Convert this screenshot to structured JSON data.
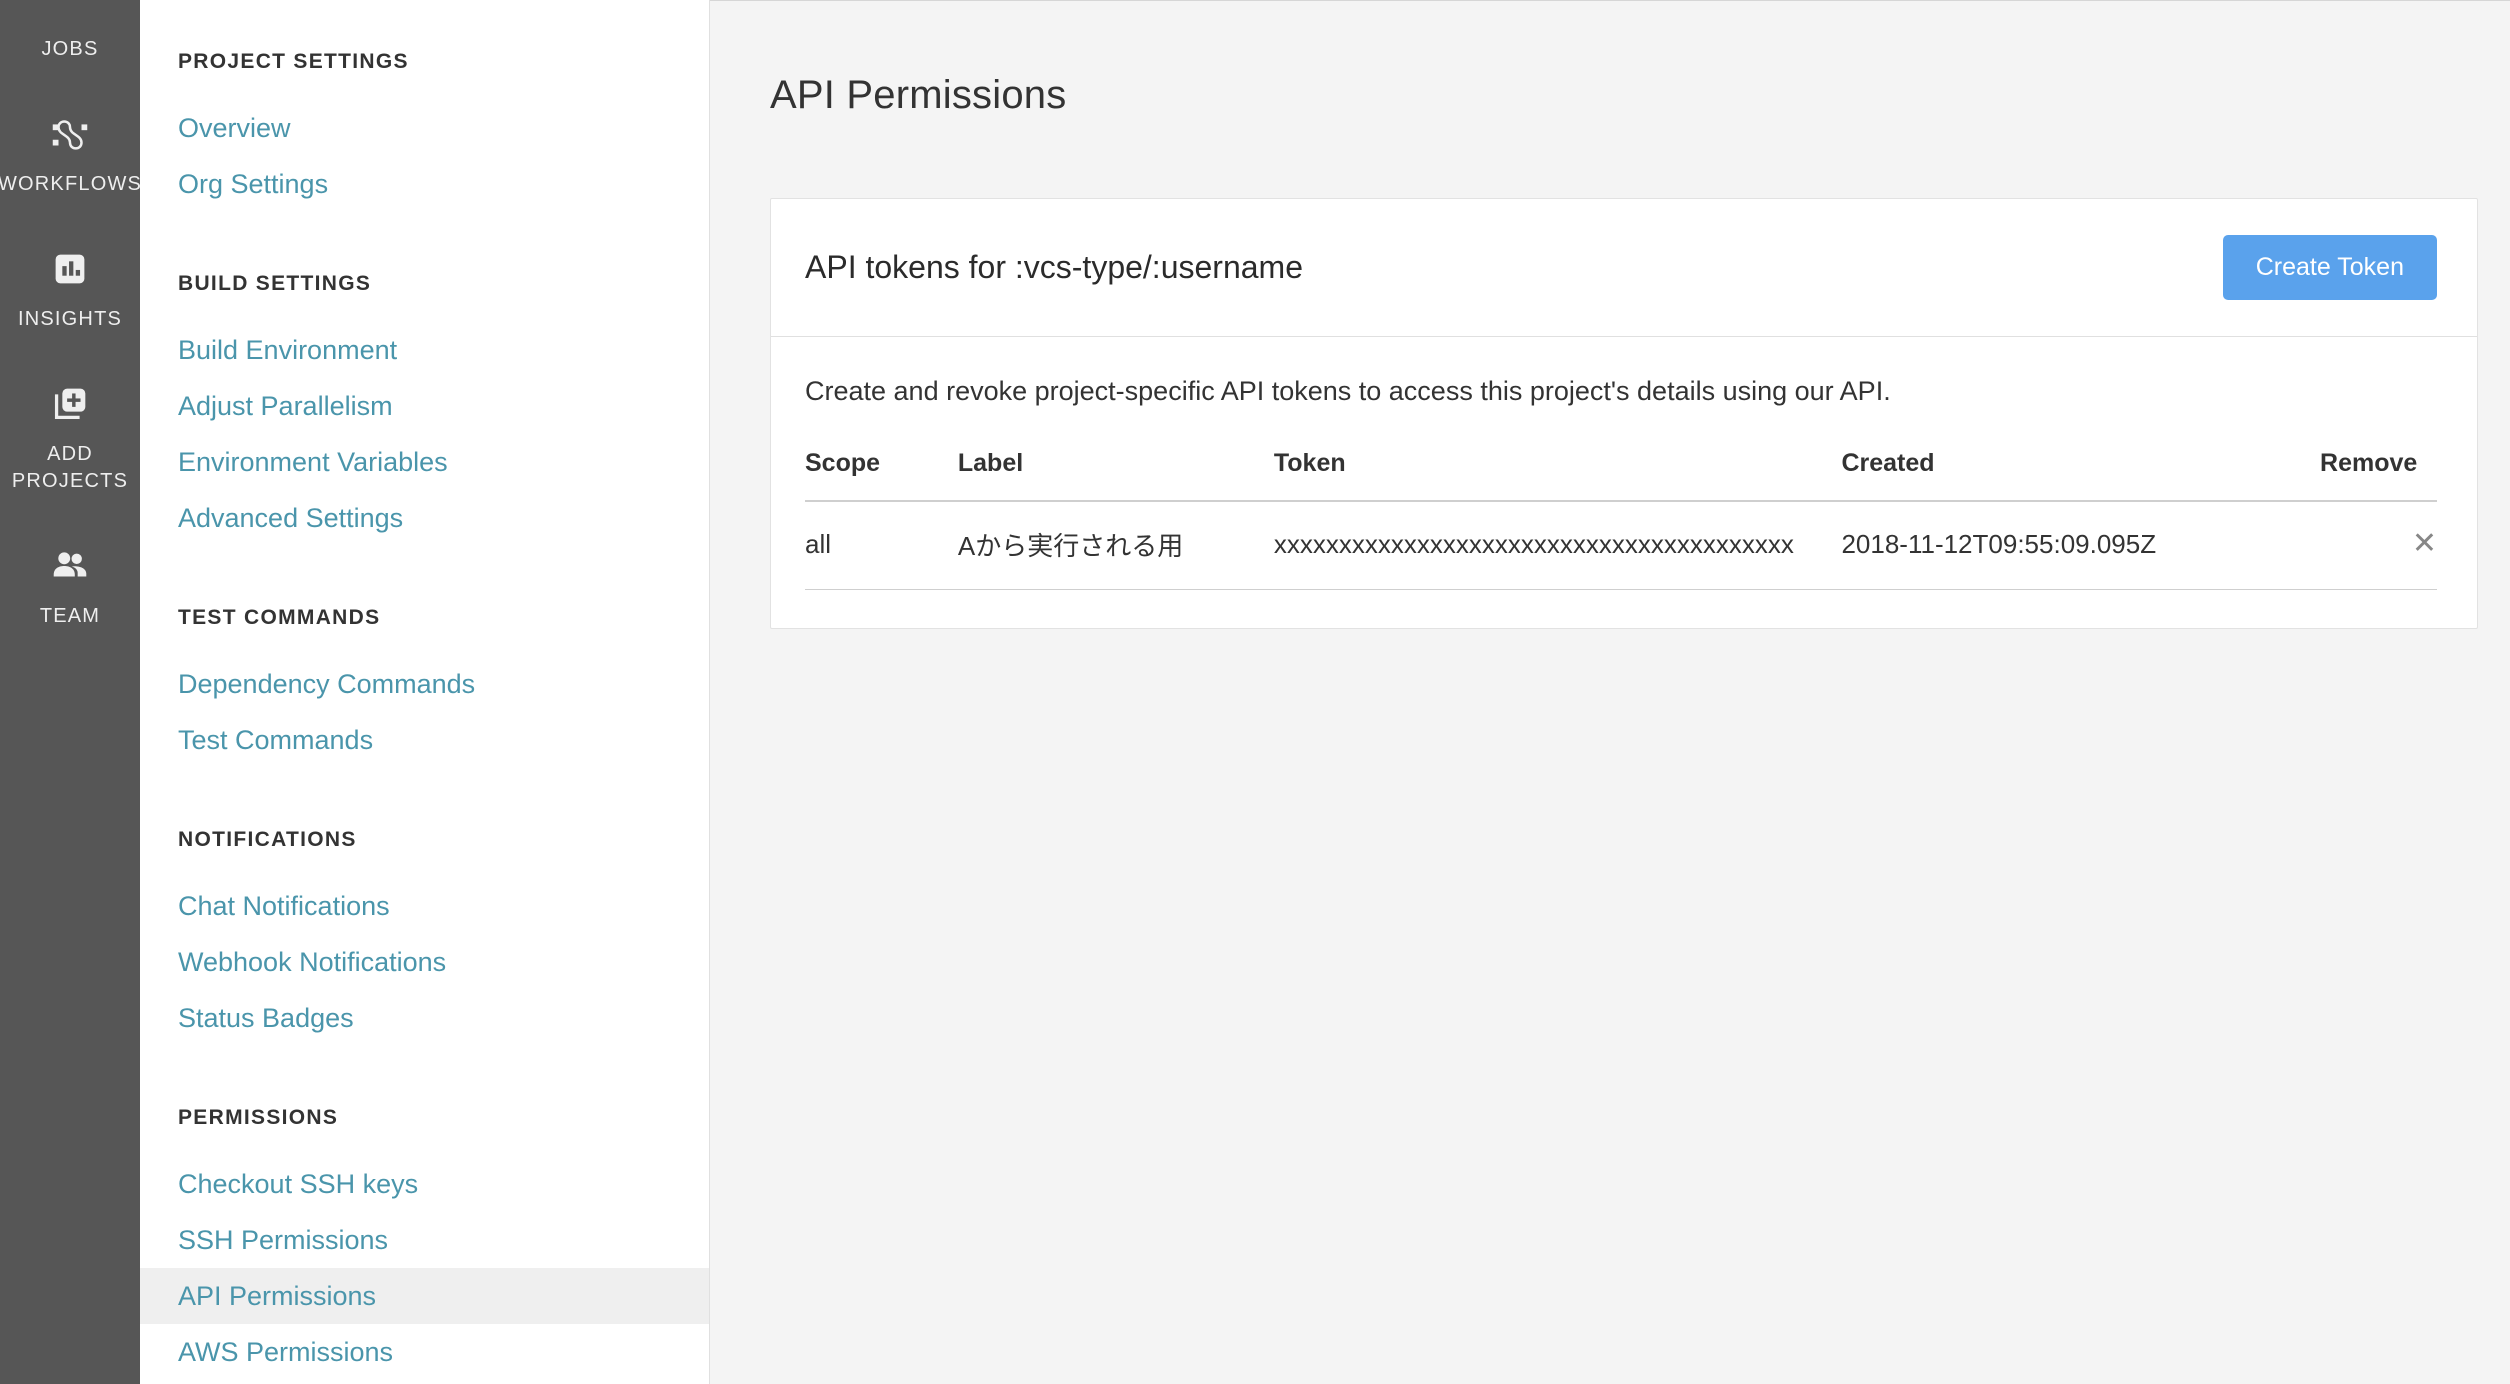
{
  "rail": {
    "items": [
      {
        "label": "JOBS",
        "icon": "jobs-icon",
        "clipped": true
      },
      {
        "label": "WORKFLOWS",
        "icon": "workflows-icon",
        "clipped": false
      },
      {
        "label": "INSIGHTS",
        "icon": "insights-icon",
        "clipped": false
      },
      {
        "label": "ADD PROJECTS",
        "icon": "add-projects-icon",
        "clipped": false
      },
      {
        "label": "TEAM",
        "icon": "team-icon",
        "clipped": false
      }
    ]
  },
  "settings_nav": {
    "sections": [
      {
        "heading": "PROJECT SETTINGS",
        "links": [
          {
            "label": "Overview",
            "active": false
          },
          {
            "label": "Org Settings",
            "active": false
          }
        ]
      },
      {
        "heading": "BUILD SETTINGS",
        "links": [
          {
            "label": "Build Environment",
            "active": false
          },
          {
            "label": "Adjust Parallelism",
            "active": false
          },
          {
            "label": "Environment Variables",
            "active": false
          },
          {
            "label": "Advanced Settings",
            "active": false
          }
        ]
      },
      {
        "heading": "TEST COMMANDS",
        "links": [
          {
            "label": "Dependency Commands",
            "active": false
          },
          {
            "label": "Test Commands",
            "active": false
          }
        ]
      },
      {
        "heading": "NOTIFICATIONS",
        "links": [
          {
            "label": "Chat Notifications",
            "active": false
          },
          {
            "label": "Webhook Notifications",
            "active": false
          },
          {
            "label": "Status Badges",
            "active": false
          }
        ]
      },
      {
        "heading": "PERMISSIONS",
        "links": [
          {
            "label": "Checkout SSH keys",
            "active": false
          },
          {
            "label": "SSH Permissions",
            "active": false
          },
          {
            "label": "API Permissions",
            "active": true
          },
          {
            "label": "AWS Permissions",
            "active": false
          }
        ]
      }
    ]
  },
  "main": {
    "page_title": "API Permissions",
    "card": {
      "title": "API tokens for :vcs-type/:username",
      "create_button": "Create Token",
      "description": "Create and revoke project-specific API tokens to access this project's details using our API.",
      "table": {
        "columns": [
          "Scope",
          "Label",
          "Token",
          "Created",
          "Remove"
        ],
        "rows": [
          {
            "scope": "all",
            "label": "Aから実行される用",
            "token": "xxxxxxxxxxxxxxxxxxxxxxxxxxxxxxxxxxxxxxxx",
            "created": "2018-11-12T09:55:09.095Z",
            "remove_icon": "close-icon"
          }
        ]
      }
    }
  },
  "colors": {
    "rail_background": "#565656",
    "link_blue": "#4a95ab",
    "primary_button": "#5aa2ec",
    "content_background": "#f4f4f4",
    "active_nav_background": "#efefef"
  }
}
